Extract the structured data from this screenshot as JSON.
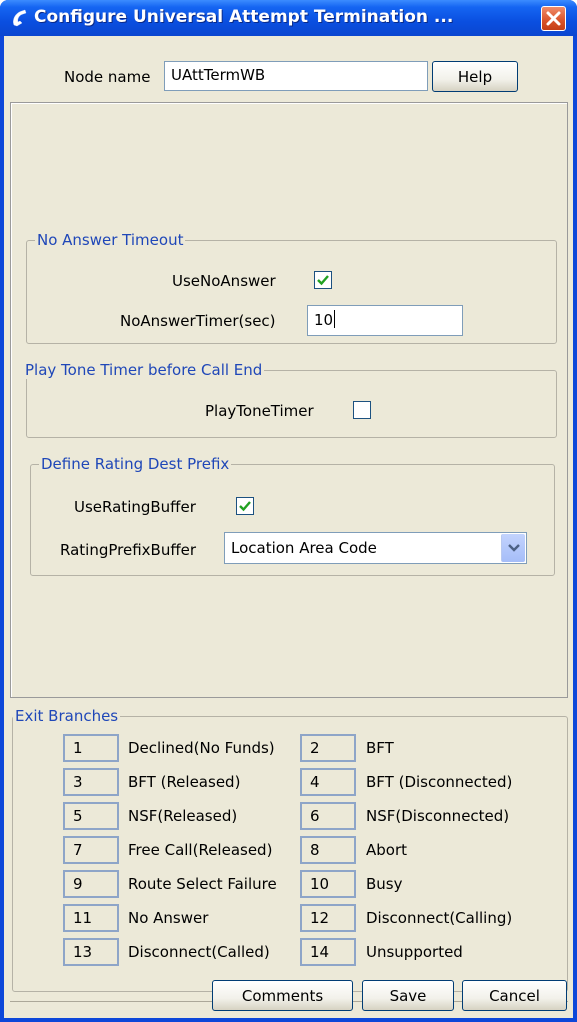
{
  "window": {
    "title": "Configure Universal Attempt Termination ...",
    "close_icon": "close-icon",
    "app_icon": "phone-icon"
  },
  "header": {
    "node_name_label": "Node name",
    "node_name_value": "UAttTermWB",
    "help_label": "Help"
  },
  "no_answer": {
    "title": "No Answer Timeout",
    "use_label": "UseNoAnswer",
    "use_checked": true,
    "timer_label": "NoAnswerTimer(sec)",
    "timer_value": "10"
  },
  "play_tone": {
    "title": "Play Tone Timer before Call End",
    "label": "PlayToneTimer",
    "checked": false
  },
  "rating": {
    "title": "Define Rating Dest Prefix",
    "use_label": "UseRatingBuffer",
    "use_checked": true,
    "prefix_label": "RatingPrefixBuffer",
    "prefix_value": "Location Area Code"
  },
  "exit_branches": {
    "title": "Exit Branches",
    "rows": [
      [
        {
          "num": "1",
          "label": "Declined(No Funds)"
        },
        {
          "num": "2",
          "label": "BFT"
        }
      ],
      [
        {
          "num": "3",
          "label": "BFT (Released)"
        },
        {
          "num": "4",
          "label": "BFT (Disconnected)"
        }
      ],
      [
        {
          "num": "5",
          "label": "NSF(Released)"
        },
        {
          "num": "6",
          "label": "NSF(Disconnected)"
        }
      ],
      [
        {
          "num": "7",
          "label": "Free Call(Released)"
        },
        {
          "num": "8",
          "label": "Abort"
        }
      ],
      [
        {
          "num": "9",
          "label": "Route Select Failure"
        },
        {
          "num": "10",
          "label": "Busy"
        }
      ],
      [
        {
          "num": "11",
          "label": "No Answer"
        },
        {
          "num": "12",
          "label": "Disconnect(Calling)"
        }
      ],
      [
        {
          "num": "13",
          "label": "Disconnect(Called)"
        },
        {
          "num": "14",
          "label": "Unsupported"
        }
      ]
    ]
  },
  "footer": {
    "comments_label": "Comments",
    "save_label": "Save",
    "cancel_label": "Cancel"
  }
}
